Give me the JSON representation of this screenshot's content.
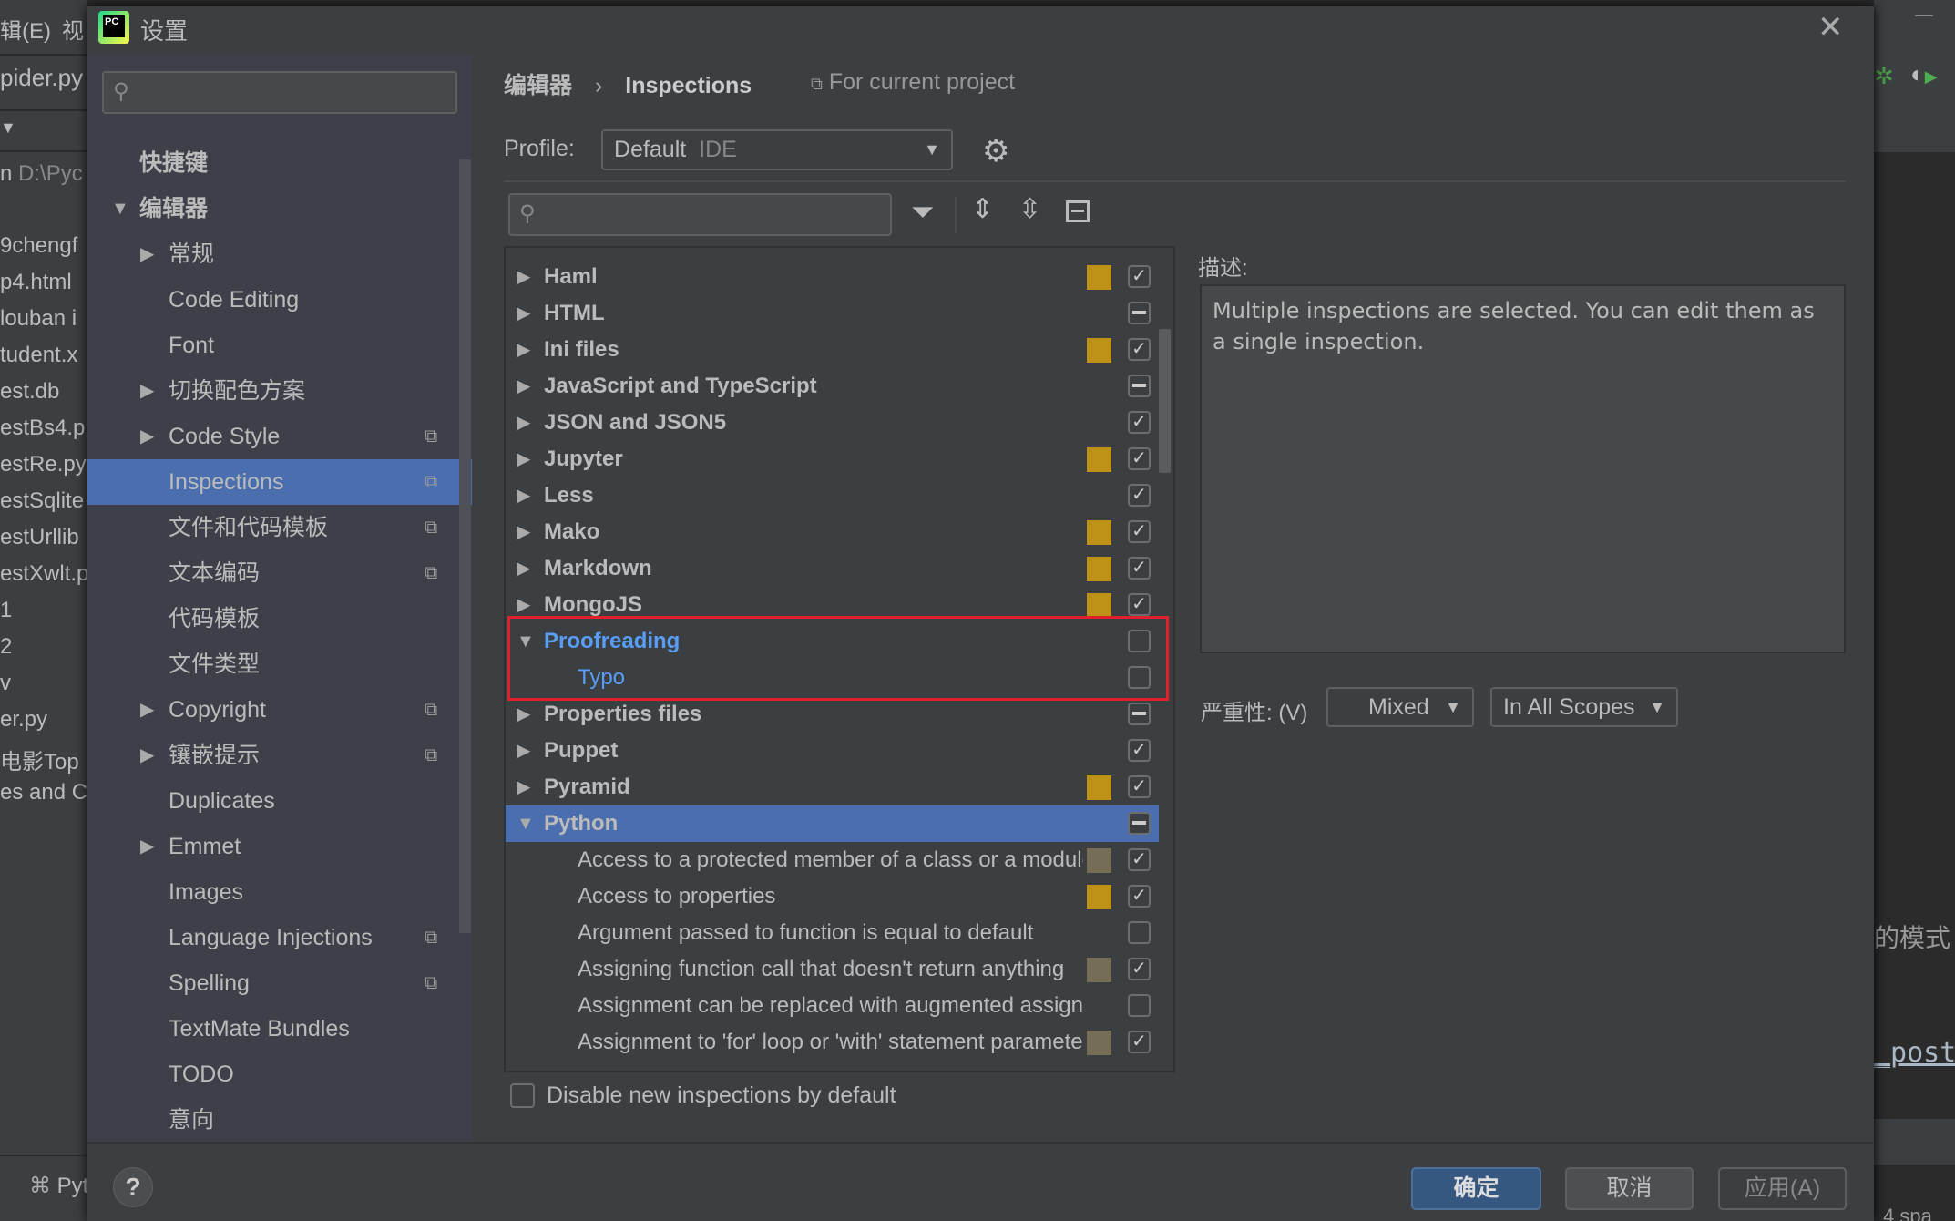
{
  "ide_background": {
    "menu": [
      "辑(E)",
      "视"
    ],
    "tab": "pider.py",
    "project_path": [
      "n",
      "D:\\Pyc"
    ],
    "files": [
      "9chengf",
      "p4.html",
      "louban i",
      "tudent.x",
      "est.db",
      "estBs4.p",
      "estRe.py",
      "estSqlite",
      "estUrllib",
      "estXwlt.p",
      "1",
      "2",
      "v",
      "er.py",
      "电影Top",
      "es and C"
    ],
    "bottom_tab": "Pyt",
    "code_fragments": [
      "的模式",
      "_post",
      "4 spa"
    ]
  },
  "dialog": {
    "title": "设置",
    "close_icon": "close-icon"
  },
  "sidebar": {
    "search_placeholder": "",
    "items": [
      {
        "label": "快捷键",
        "level": 0,
        "arrow": "",
        "bold": true
      },
      {
        "label": "编辑器",
        "level": 0,
        "arrow": "down",
        "bold": true
      },
      {
        "label": "常规",
        "level": 1,
        "arrow": "right"
      },
      {
        "label": "Code Editing",
        "level": 1,
        "arrow": ""
      },
      {
        "label": "Font",
        "level": 1,
        "arrow": ""
      },
      {
        "label": "切换配色方案",
        "level": 1,
        "arrow": "right"
      },
      {
        "label": "Code Style",
        "level": 1,
        "arrow": "right",
        "project": true
      },
      {
        "label": "Inspections",
        "level": 1,
        "arrow": "",
        "project": true,
        "selected": true
      },
      {
        "label": "文件和代码模板",
        "level": 1,
        "arrow": "",
        "project": true
      },
      {
        "label": "文本编码",
        "level": 1,
        "arrow": "",
        "project": true
      },
      {
        "label": "代码模板",
        "level": 1,
        "arrow": ""
      },
      {
        "label": "文件类型",
        "level": 1,
        "arrow": ""
      },
      {
        "label": "Copyright",
        "level": 1,
        "arrow": "right",
        "project": true
      },
      {
        "label": "镶嵌提示",
        "level": 1,
        "arrow": "right",
        "project": true
      },
      {
        "label": "Duplicates",
        "level": 1,
        "arrow": ""
      },
      {
        "label": "Emmet",
        "level": 1,
        "arrow": "right"
      },
      {
        "label": "Images",
        "level": 1,
        "arrow": ""
      },
      {
        "label": "Language Injections",
        "level": 1,
        "arrow": "",
        "project": true
      },
      {
        "label": "Spelling",
        "level": 1,
        "arrow": "",
        "project": true
      },
      {
        "label": "TextMate Bundles",
        "level": 1,
        "arrow": ""
      },
      {
        "label": "TODO",
        "level": 1,
        "arrow": ""
      },
      {
        "label": "意向",
        "level": 1,
        "arrow": ""
      }
    ]
  },
  "breadcrumb": {
    "parent": "编辑器",
    "separator": "›",
    "current": "Inspections",
    "scope": "For current project"
  },
  "profile": {
    "label": "Profile:",
    "value": "Default",
    "suffix": "IDE"
  },
  "tree": {
    "search_placeholder": "",
    "rows": [
      {
        "label": "Haml",
        "level": 0,
        "arrow": "right",
        "severity": "warning",
        "check": "checked"
      },
      {
        "label": "HTML",
        "level": 0,
        "arrow": "right",
        "severity": null,
        "check": "mixed"
      },
      {
        "label": "Ini files",
        "level": 0,
        "arrow": "right",
        "severity": "warning",
        "check": "checked"
      },
      {
        "label": "JavaScript and TypeScript",
        "level": 0,
        "arrow": "right",
        "severity": null,
        "check": "mixed"
      },
      {
        "label": "JSON and JSON5",
        "level": 0,
        "arrow": "right",
        "severity": null,
        "check": "checked"
      },
      {
        "label": "Jupyter",
        "level": 0,
        "arrow": "right",
        "severity": "warning",
        "check": "checked"
      },
      {
        "label": "Less",
        "level": 0,
        "arrow": "right",
        "severity": null,
        "check": "checked"
      },
      {
        "label": "Mako",
        "level": 0,
        "arrow": "right",
        "severity": "warning",
        "check": "checked"
      },
      {
        "label": "Markdown",
        "level": 0,
        "arrow": "right",
        "severity": "warning",
        "check": "checked"
      },
      {
        "label": "MongoJS",
        "level": 0,
        "arrow": "right",
        "severity": "warning",
        "check": "checked"
      },
      {
        "label": "Proofreading",
        "level": 0,
        "arrow": "down",
        "severity": null,
        "check": "unchecked",
        "highlight": true
      },
      {
        "label": "Typo",
        "level": 1,
        "arrow": "",
        "severity": null,
        "check": "unchecked",
        "highlight": true
      },
      {
        "label": "Properties files",
        "level": 0,
        "arrow": "right",
        "severity": null,
        "check": "mixed"
      },
      {
        "label": "Puppet",
        "level": 0,
        "arrow": "right",
        "severity": null,
        "check": "checked"
      },
      {
        "label": "Pyramid",
        "level": 0,
        "arrow": "right",
        "severity": "warning",
        "check": "checked"
      },
      {
        "label": "Python",
        "level": 0,
        "arrow": "down",
        "severity": null,
        "check": "mixed",
        "selected": true
      },
      {
        "label": "Access to a protected member of a class or a module",
        "level": 1,
        "arrow": "",
        "severity": "weak-warning",
        "check": "checked"
      },
      {
        "label": "Access to properties",
        "level": 1,
        "arrow": "",
        "severity": "warning",
        "check": "checked"
      },
      {
        "label": "Argument passed to function is equal to default",
        "level": 1,
        "arrow": "",
        "severity": null,
        "check": "unchecked"
      },
      {
        "label": "Assigning function call that doesn't return anything",
        "level": 1,
        "arrow": "",
        "severity": "weak-warning",
        "check": "checked"
      },
      {
        "label": "Assignment can be replaced with augmented assignment",
        "level": 1,
        "arrow": "",
        "severity": null,
        "check": "unchecked"
      },
      {
        "label": "Assignment to 'for' loop or 'with' statement parameter",
        "level": 1,
        "arrow": "",
        "severity": "weak-warning",
        "check": "checked"
      }
    ]
  },
  "disable_new": {
    "label": "Disable new inspections by default",
    "checked": false
  },
  "description": {
    "label": "描述:",
    "text": "Multiple inspections are selected. You can edit them as a single inspection."
  },
  "severity": {
    "label": "严重性:",
    "mnemonic": "(V)",
    "value": "Mixed",
    "scope": "In All Scopes"
  },
  "buttons": {
    "ok": "确定",
    "cancel": "取消",
    "apply": "应用(A)",
    "help": "?"
  },
  "colors": {
    "selection": "#4b6eaf",
    "warning": "#be9117",
    "weak_warning": "#756d56",
    "highlight_text": "#589df6",
    "highlight_box": "#e0202a",
    "ok_button": "#365880"
  }
}
